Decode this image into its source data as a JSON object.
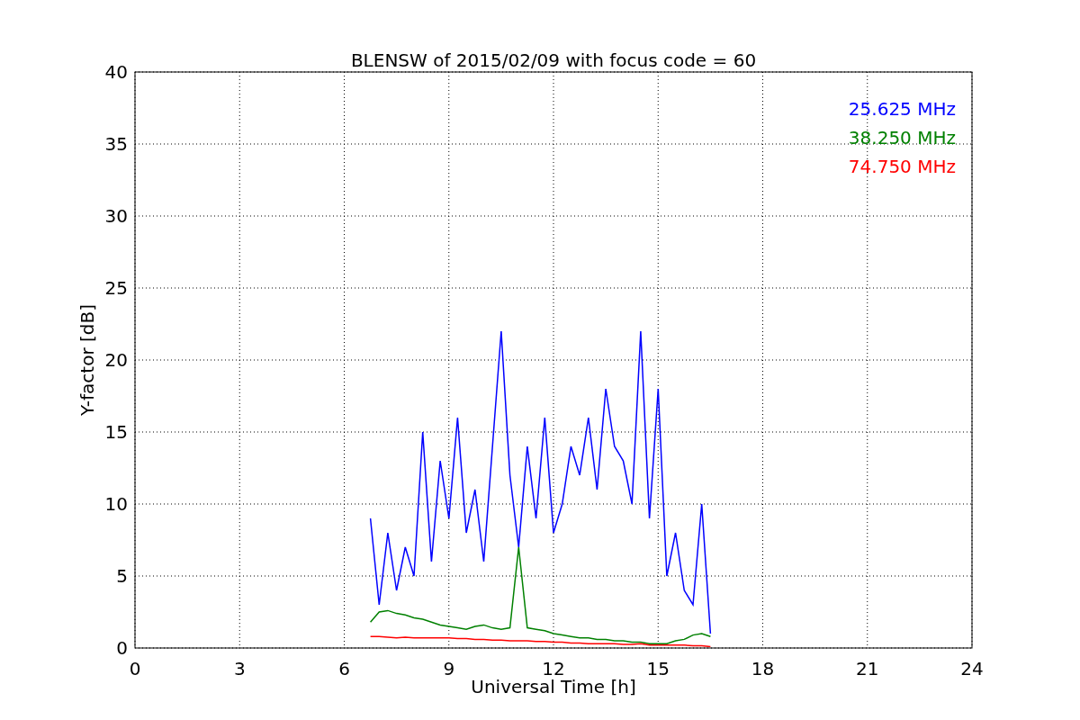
{
  "chart_data": {
    "type": "line",
    "title": "BLENSW of 2015/02/09 with focus code = 60",
    "xlabel": "Universal Time [h]",
    "ylabel": "Y-factor [dB]",
    "x": [
      6.75,
      7,
      7.25,
      7.5,
      7.75,
      8,
      8.25,
      8.5,
      8.75,
      9,
      9.25,
      9.5,
      9.75,
      10,
      10.25,
      10.5,
      10.75,
      11,
      11.25,
      11.5,
      11.75,
      12,
      12.25,
      12.5,
      12.75,
      13,
      13.25,
      13.5,
      13.75,
      14,
      14.25,
      14.5,
      14.75,
      15,
      15.25,
      15.5,
      15.75,
      16,
      16.25,
      16.5
    ],
    "series": [
      {
        "name": "25.625 MHz",
        "color": "#0000ff",
        "values": [
          9,
          3,
          8,
          4,
          7,
          5,
          15,
          6,
          13,
          9,
          16,
          8,
          11,
          6,
          14,
          22,
          12,
          7,
          14,
          9,
          16,
          8,
          10,
          14,
          12,
          16,
          11,
          18,
          14,
          13,
          10,
          22,
          9,
          18,
          5,
          8,
          4,
          3,
          10,
          1
        ]
      },
      {
        "name": "38.250 MHz",
        "color": "#008000",
        "values": [
          1.8,
          2.5,
          2.6,
          2.4,
          2.3,
          2.1,
          2,
          1.8,
          1.6,
          1.5,
          1.4,
          1.3,
          1.5,
          1.6,
          1.4,
          1.3,
          1.4,
          7,
          1.4,
          1.3,
          1.2,
          1,
          0.9,
          0.8,
          0.7,
          0.7,
          0.6,
          0.6,
          0.5,
          0.5,
          0.4,
          0.4,
          0.3,
          0.3,
          0.3,
          0.5,
          0.6,
          0.9,
          1,
          0.8
        ]
      },
      {
        "name": "74.750 MHz",
        "color": "#ff0000",
        "values": [
          0.8,
          0.8,
          0.75,
          0.7,
          0.75,
          0.7,
          0.7,
          0.7,
          0.7,
          0.7,
          0.65,
          0.65,
          0.6,
          0.6,
          0.55,
          0.55,
          0.5,
          0.5,
          0.5,
          0.45,
          0.45,
          0.4,
          0.4,
          0.35,
          0.35,
          0.3,
          0.3,
          0.3,
          0.3,
          0.25,
          0.25,
          0.3,
          0.2,
          0.2,
          0.2,
          0.2,
          0.2,
          0.15,
          0.15,
          0.1
        ]
      }
    ],
    "xlim": [
      0,
      24
    ],
    "ylim": [
      0,
      40
    ],
    "xticks": [
      0,
      3,
      6,
      9,
      12,
      15,
      18,
      21,
      24
    ],
    "yticks": [
      0,
      5,
      10,
      15,
      20,
      25,
      30,
      35,
      40
    ],
    "grid": true
  }
}
